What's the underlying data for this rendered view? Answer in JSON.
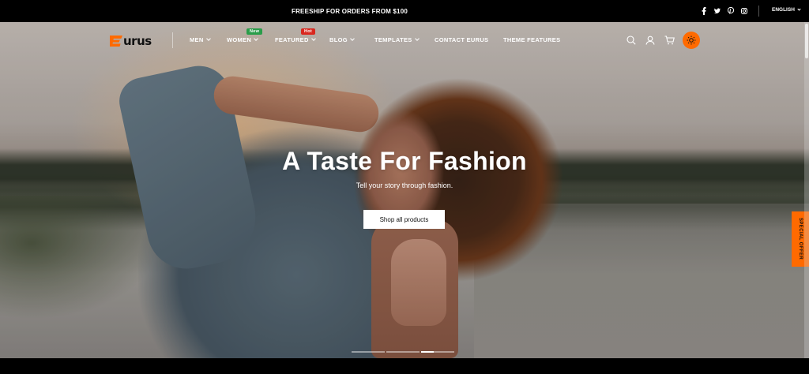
{
  "announcement": {
    "text": "FREESHIP FOR ORDERS FROM $100"
  },
  "social": [
    "facebook-icon",
    "twitter-icon",
    "pinterest-icon",
    "instagram-icon"
  ],
  "language": {
    "label": "ENGLISH"
  },
  "logo": {
    "text": "urus"
  },
  "nav": {
    "items": [
      {
        "label": "MEN"
      },
      {
        "label": "WOMEN",
        "badge": "New"
      },
      {
        "label": "FEATURED",
        "badge": "Hot"
      },
      {
        "label": "BLOG"
      },
      {
        "label": "TEMPLATES"
      },
      {
        "label": "CONTACT EURUS"
      },
      {
        "label": "THEME FEATURES"
      }
    ]
  },
  "hero": {
    "title": "A Taste For Fashion",
    "subtitle": "Tell your story through fashion.",
    "button_label": "Shop all products",
    "slides_total": 3,
    "active_slide": 3
  },
  "offer_tab": {
    "label": "SPECIAL OFFER"
  },
  "colors": {
    "accent": "#ff6a00",
    "badge_new": "#2a9d4a",
    "badge_hot": "#d9281f"
  }
}
